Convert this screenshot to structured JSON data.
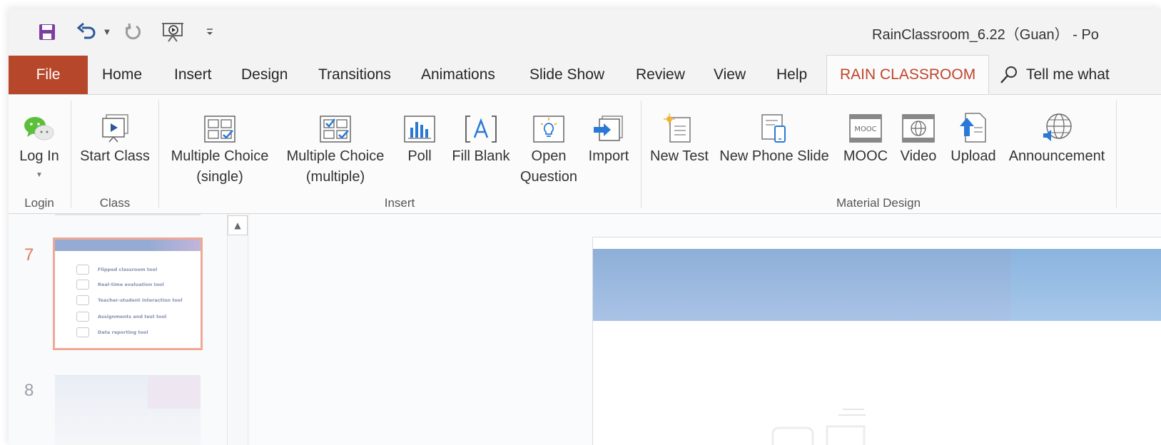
{
  "window": {
    "title": "RainClassroom_6.22（Guan）  -  Po"
  },
  "colors": {
    "file_tab_bg": "#b7472a",
    "active_tab_text": "#c0442b",
    "accent_blue": "#2b579a",
    "thumb_selected_border": "#f0a896",
    "slide_number_selected": "#e07a5f"
  },
  "quick_access": {
    "save_icon": "save-icon",
    "undo_icon": "undo-icon",
    "redo_icon": "redo-icon",
    "present_icon": "presentation-icon",
    "customize_icon": "customize-dropdown-icon"
  },
  "tabs": [
    "File",
    "Home",
    "Insert",
    "Design",
    "Transitions",
    "Animations",
    "Slide Show",
    "Review",
    "View",
    "Help",
    "RAIN CLASSROOM"
  ],
  "tell_me": "Tell me what",
  "ribbon": {
    "groups": [
      "Login",
      "Class",
      "Insert",
      "Material Design"
    ],
    "buttons": {
      "login": "Log In",
      "start_class": "Start Class",
      "mc_single_1": "Multiple Choice",
      "mc_single_2": "(single)",
      "mc_multi_1": "Multiple Choice",
      "mc_multi_2": "(multiple)",
      "poll": "Poll",
      "fill_blank": "Fill Blank",
      "open_q_1": "Open",
      "open_q_2": "Question",
      "import": "Import",
      "new_test": "New Test",
      "new_phone_slide": "New Phone Slide",
      "mooc": "MOOC",
      "video": "Video",
      "upload": "Upload",
      "announcement": "Announcement"
    },
    "mooc_icon_text": "MOOC"
  },
  "thumbnails": {
    "slide_7_number": "7",
    "slide_8_number": "8",
    "slide_7_items": [
      "Flipped classroom tool",
      "Real-time evaluation tool",
      "Teacher-student interaction tool",
      "Assignments and test tool",
      "Data reporting tool"
    ]
  }
}
